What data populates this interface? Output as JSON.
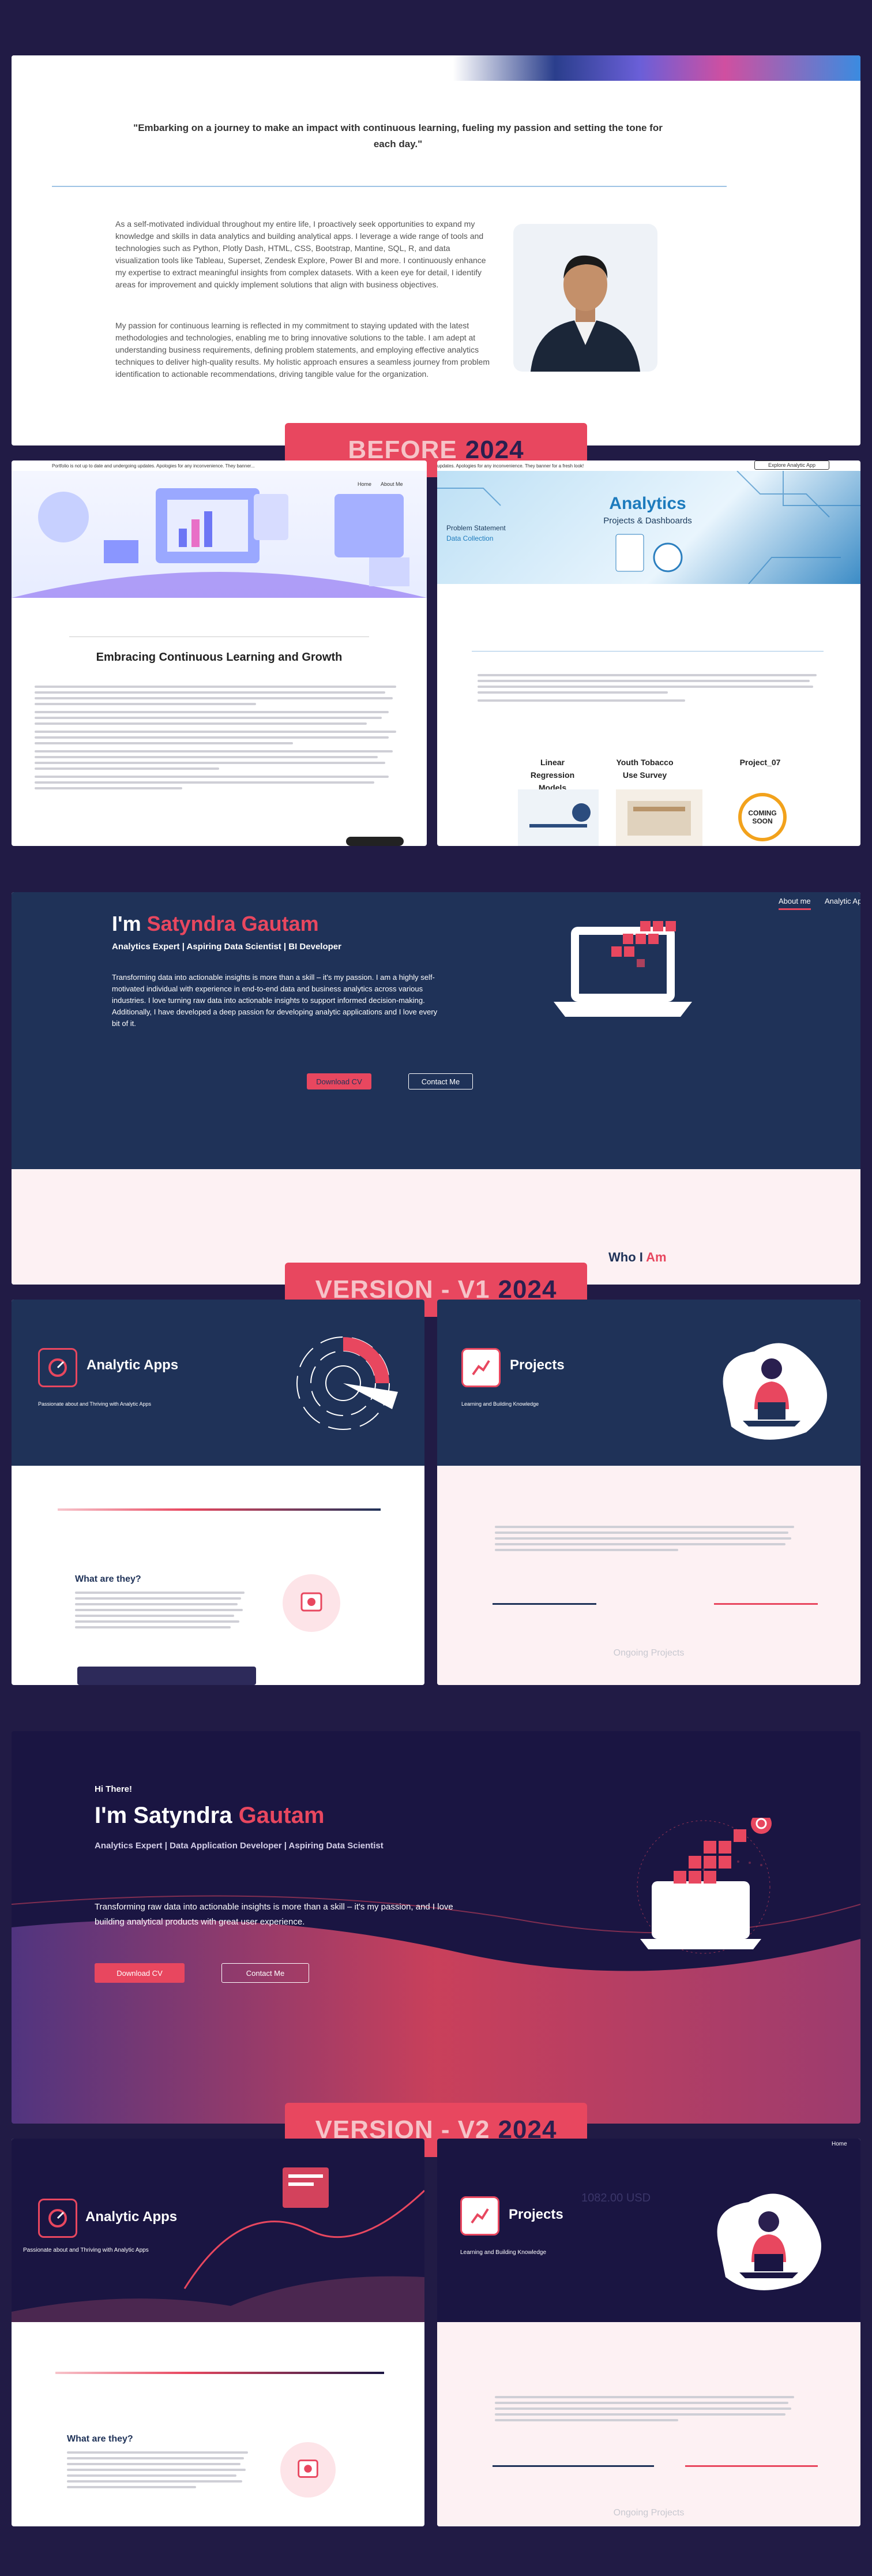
{
  "hero_quote": "\"Embarking on a journey to make an impact with continuous learning, fueling my passion and setting the tone for each day.\"",
  "about_paragraphs": [
    "As a self-motivated individual throughout my entire life, I proactively seek opportunities to expand my knowledge and skills in data analytics and building analytical apps. I leverage a wide range of tools and technologies such as Python, Plotly Dash, HTML, CSS, Bootstrap, Mantine, SQL, R, and data visualization tools like Tableau, Superset, Zendesk Explore, Power BI and more. I continuously enhance my expertise to extract meaningful insights from complex datasets. With a keen eye for detail, I identify areas for improvement and quickly implement solutions that align with business objectives.",
    "My passion for continuous learning is reflected in my commitment to staying updated with the latest methodologies and technologies, enabling me to bring innovative solutions to the table. I am adept at understanding business requirements, defining problem statements, and employing effective analytics techniques to deliver high-quality results. My holistic approach ensures a seamless journey from problem identification to actionable recommendations, driving tangible value for the organization."
  ],
  "banners": {
    "before": {
      "label": "BEFORE",
      "year": "2024"
    },
    "v1": {
      "label": "VERSION - V1",
      "year": "2024"
    },
    "v2": {
      "label": "VERSION - V2",
      "year": "2024"
    }
  },
  "before": {
    "ticker_left": "Portfolio is not up to date and undergoing updates. Apologies for any inconvenience. They banner...",
    "ticker_right": "updates. Apologies for any inconvenience. They banner for a fresh look!",
    "explore_button": "Explore Analytic App",
    "nav_home": "Home",
    "nav_about": "About Me",
    "heading": "Embracing Continuous Learning and Growth",
    "analytics_title": "Analytics",
    "analytics_subtitle": "Projects & Dashboards",
    "problem_statement": "Problem Statement",
    "data_collection": "Data Collection",
    "projects": [
      {
        "title": "Linear Regression Models"
      },
      {
        "title": "Youth Tobacco Use Survey"
      },
      {
        "title": "Project_07"
      }
    ],
    "coming_soon": "COMING SOON"
  },
  "v1": {
    "nav": [
      "About me",
      "Analytic App"
    ],
    "greeting_prefix": "I'm ",
    "name": "Satyndra Gautam",
    "roles": "Analytics Expert | Aspiring Data Scientist | BI Developer",
    "intro": "Transforming data into actionable insights is more than a skill – it's my passion. I am a highly self-motivated individual with experience in end-to-end data and business analytics across various industries. I love turning raw data into actionable insights to support informed decision-making. Additionally, I have developed a deep passion for developing analytic applications and I love every bit of it.",
    "download_cv": "Download CV",
    "contact_me": "Contact Me",
    "who_prefix": "Who I ",
    "who_suffix": "Am",
    "analytic_apps_title": "Analytic Apps",
    "analytic_apps_sub": "Passionate about and Thriving with Analytic Apps",
    "projects_title": "Projects",
    "projects_sub": "Learning and Building Knowledge",
    "what_are_they": "What are they?",
    "ongoing": "Ongoing Projects"
  },
  "v2": {
    "hi": "Hi There!",
    "greeting_prefix": "I'm Satyndra ",
    "name_highlight": "Gautam",
    "roles": "Analytics Expert | Data Application Developer | Aspiring Data Scientist",
    "intro": "Transforming raw data into actionable insights is more than a skill – it's my passion, and I love building analytical products with great user experience.",
    "download_cv": "Download CV",
    "contact_me": "Contact Me",
    "nav_home": "Home",
    "analytic_apps_title": "Analytic Apps",
    "analytic_apps_sub": "Passionate about and Thriving with Analytic Apps",
    "projects_title": "Projects",
    "projects_sub": "Learning and Building Knowledge",
    "price_tag": "1082.00 USD",
    "what_are_they": "What are they?",
    "ongoing": "Ongoing Projects"
  },
  "colors": {
    "accent": "#e8475f",
    "navy": "#1f3258",
    "bg": "#211b45",
    "pink": "#fdf1f3"
  }
}
